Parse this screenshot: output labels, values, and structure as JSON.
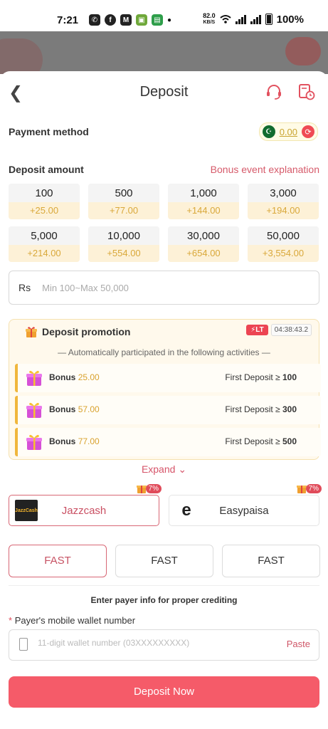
{
  "status_bar": {
    "time": "7:21",
    "net_speed": "82.0",
    "net_unit": "KB/S",
    "battery": "100%"
  },
  "header": {
    "title": "Deposit"
  },
  "payment_method": {
    "label": "Payment method",
    "balance": "0.00"
  },
  "deposit_amount": {
    "label": "Deposit amount",
    "bonus_link": "Bonus event explanation",
    "options": [
      {
        "value": "100",
        "bonus": "+25.00"
      },
      {
        "value": "500",
        "bonus": "+77.00"
      },
      {
        "value": "1,000",
        "bonus": "+144.00"
      },
      {
        "value": "3,000",
        "bonus": "+194.00"
      },
      {
        "value": "5,000",
        "bonus": "+214.00"
      },
      {
        "value": "10,000",
        "bonus": "+554.00"
      },
      {
        "value": "30,000",
        "bonus": "+654.00"
      },
      {
        "value": "50,000",
        "bonus": "+3,554.00"
      }
    ],
    "currency": "Rs",
    "placeholder": "Min 100~Max 50,000"
  },
  "promotion": {
    "title": "Deposit promotion",
    "badge": "LT",
    "countdown": "04:38:43.2",
    "subtitle": "Automatically participated in the following activities",
    "items": [
      {
        "label": "Bonus",
        "value": "25.00",
        "condition": "First Deposit ≥",
        "threshold": "100"
      },
      {
        "label": "Bonus",
        "value": "57.00",
        "condition": "First Deposit ≥",
        "threshold": "300"
      },
      {
        "label": "Bonus",
        "value": "77.00",
        "condition": "First Deposit ≥",
        "threshold": "500"
      }
    ],
    "expand": "Expand"
  },
  "channels": [
    {
      "name": "Jazzcash",
      "badge": "7%",
      "logo_text": "JazzCash"
    },
    {
      "name": "Easypaisa",
      "badge": "7%",
      "logo_text": "e"
    }
  ],
  "speed_options": [
    "FAST",
    "FAST",
    "FAST"
  ],
  "payer": {
    "hint": "Enter payer info for proper crediting",
    "required_mark": "*",
    "label": "Payer's mobile wallet number",
    "placeholder": "11-digit wallet number (03XXXXXXXXX)",
    "paste": "Paste"
  },
  "submit": {
    "label": "Deposit Now"
  },
  "colors": {
    "accent": "#f55b69",
    "bonus_gold": "#d9a83a"
  }
}
